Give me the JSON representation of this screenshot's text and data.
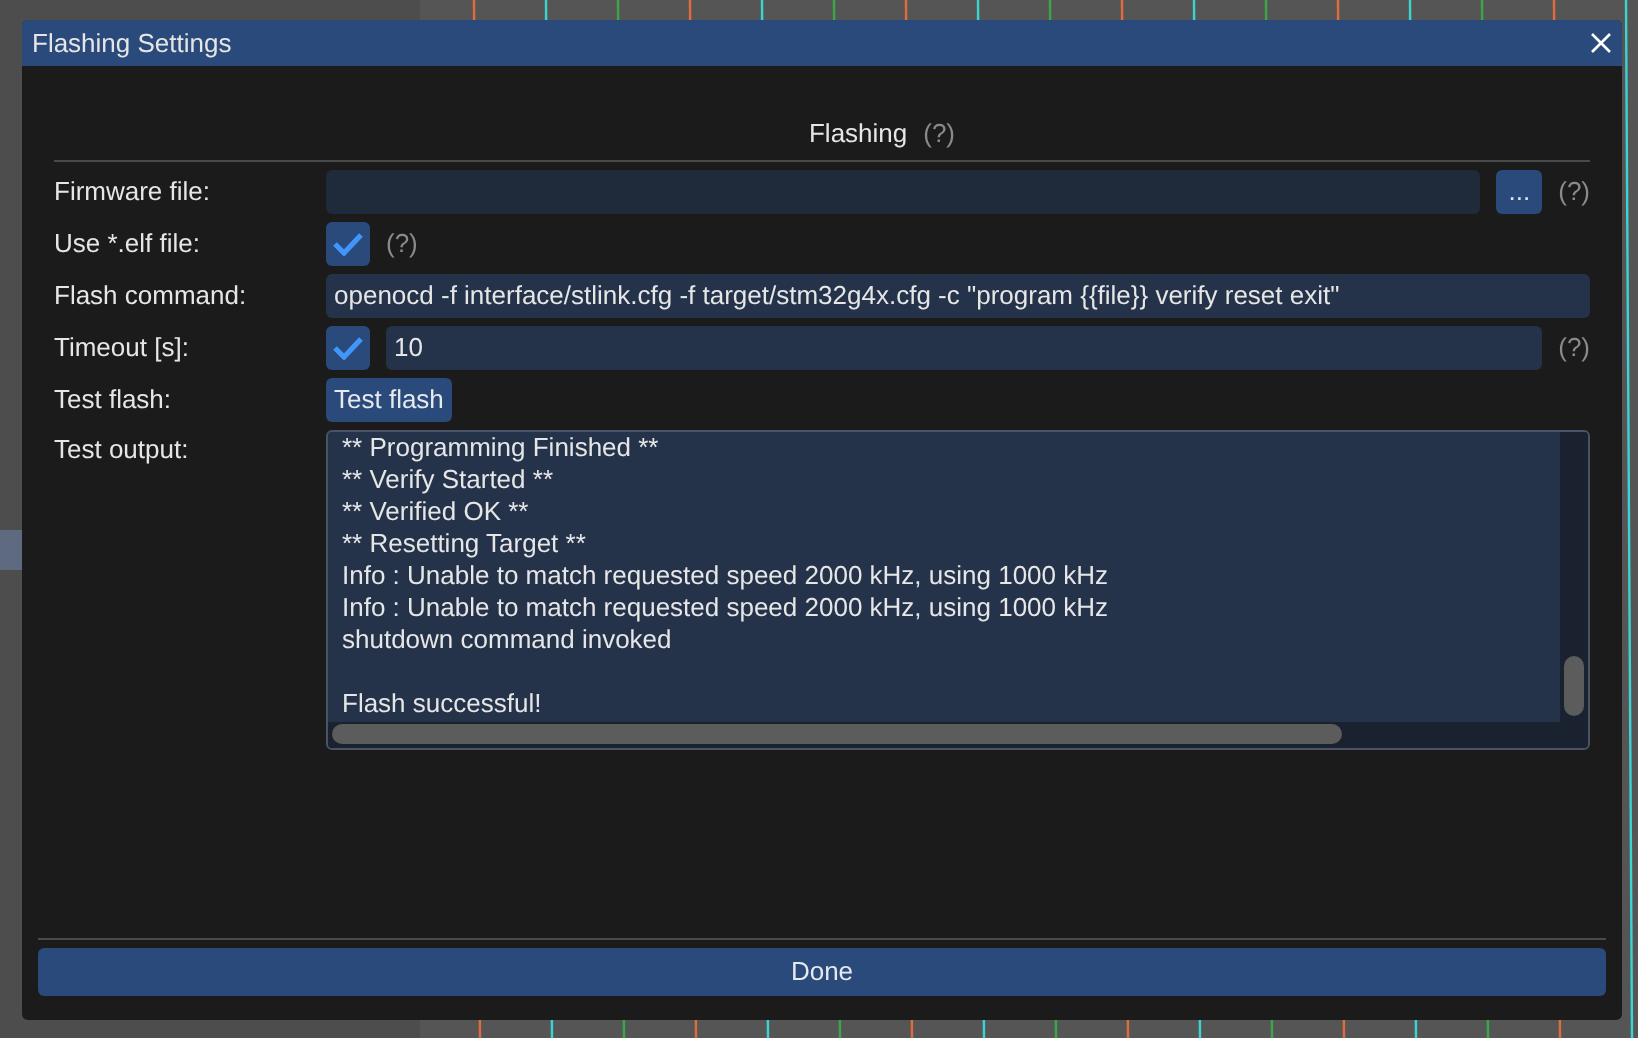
{
  "window": {
    "title": "Flashing Settings"
  },
  "section": {
    "title": "Flashing",
    "help": "(?)"
  },
  "fields": [
    {
      "kind": "file",
      "label": "Firmware file:",
      "button": "...",
      "help": "(?)"
    },
    {
      "kind": "check",
      "label": "Use *.elf file:",
      "checked": true,
      "help": "(?)"
    },
    {
      "kind": "text",
      "label": "Flash command:",
      "value": "openocd -f interface/stlink.cfg -f target/stm32g4x.cfg -c \"program {{file}} verify reset exit\""
    },
    {
      "kind": "check_text",
      "label": "Timeout [s]:",
      "checked": true,
      "value": "10",
      "help": "(?)"
    },
    {
      "kind": "button",
      "label": "Test flash:",
      "button": "Test flash"
    },
    {
      "kind": "output",
      "label": "Test output:",
      "lines": [
        {
          "kind": "text",
          "text": "** Programming Finished **"
        },
        {
          "kind": "text",
          "text": "** Verify Started **"
        },
        {
          "kind": "text",
          "text": "** Verified OK **"
        },
        {
          "kind": "text",
          "text": "** Resetting Target **"
        },
        {
          "kind": "text",
          "text": "Info : Unable to match requested speed 2000 kHz, using 1000 kHz"
        },
        {
          "kind": "text",
          "text": "Info : Unable to match requested speed 2000 kHz, using 1000 kHz"
        },
        {
          "kind": "text",
          "text": "shutdown command invoked"
        },
        {
          "kind": "blank"
        },
        {
          "kind": "text",
          "text": "Flash successful!"
        }
      ]
    }
  ],
  "footer": {
    "button": "Done"
  }
}
